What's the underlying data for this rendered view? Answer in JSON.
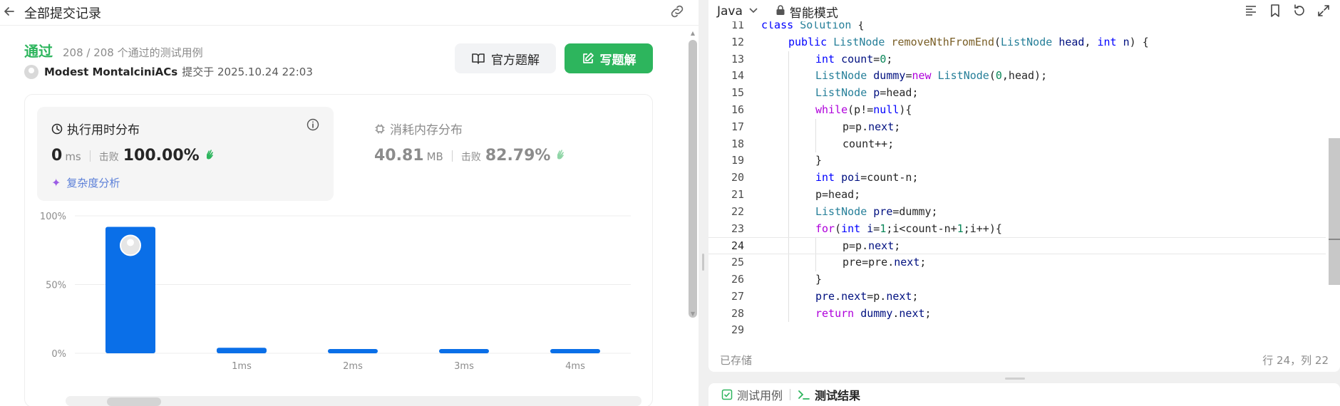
{
  "header": {
    "back_icon": "arrow-left-icon",
    "title": "全部提交记录",
    "link_icon": "link-icon"
  },
  "submission": {
    "status": "通过",
    "cases": "208 / 208 个通过的测试用例",
    "author": "Modest MontalciniACs",
    "submitted": "提交于 2025.10.24 22:03"
  },
  "buttons": {
    "official": "官方题解",
    "write": "写题解"
  },
  "runtime": {
    "title": "执行用时分布",
    "value": "0",
    "unit": "ms",
    "beat_label": "击败",
    "beat_pct": "100.00%",
    "complexity": "复杂度分析"
  },
  "memory": {
    "title": "消耗内存分布",
    "value": "40.81",
    "unit": "MB",
    "beat_label": "击败",
    "beat_pct": "82.79%"
  },
  "chart_data": {
    "type": "bar",
    "categories": [
      "0ms",
      "1ms",
      "2ms",
      "3ms",
      "4ms"
    ],
    "x_tick_labels": [
      "",
      "1ms",
      "2ms",
      "3ms",
      "4ms"
    ],
    "values": [
      92,
      4,
      3,
      3,
      3
    ],
    "y_tick_labels": [
      "100%",
      "50%",
      "0%"
    ],
    "ylim": [
      0,
      100
    ],
    "highlight_index": 0,
    "bar_color": "#0a6fe8",
    "grid": true
  },
  "editor": {
    "language": "Java",
    "mode": "智能模式",
    "saved": "已存储",
    "cursor": "行 24，列 22",
    "code_lines": [
      {
        "n": "11",
        "indent": 0,
        "html": "<span class=\"k\">class</span> <span class=\"t\">Solution</span> {"
      },
      {
        "n": "12",
        "indent": 1,
        "html": "<span class=\"k\">public</span> <span class=\"t\">ListNode</span> <span class=\"f\">removeNthFromEnd</span>(<span class=\"t\">ListNode</span> <span class=\"v\">head</span>, <span class=\"k\">int</span> <span class=\"v\">n</span>) {"
      },
      {
        "n": "13",
        "indent": 2,
        "html": "<span class=\"k\">int</span> <span class=\"v\">count</span>=<span class=\"n\">0</span>;"
      },
      {
        "n": "14",
        "indent": 2,
        "html": "<span class=\"t\">ListNode</span> <span class=\"v\">dummy</span>=<span class=\"kw\">new</span> <span class=\"t\">ListNode</span>(<span class=\"n\">0</span>,head);"
      },
      {
        "n": "15",
        "indent": 2,
        "html": "<span class=\"t\">ListNode</span> <span class=\"v\">p</span>=head;"
      },
      {
        "n": "16",
        "indent": 2,
        "html": "<span class=\"kw\">while</span>(p!=<span class=\"k\">null</span>){"
      },
      {
        "n": "17",
        "indent": 3,
        "html": "p=p.<span class=\"v\">next</span>;"
      },
      {
        "n": "18",
        "indent": 3,
        "html": "count++;"
      },
      {
        "n": "19",
        "indent": 2,
        "html": "}"
      },
      {
        "n": "20",
        "indent": 2,
        "html": "<span class=\"k\">int</span> <span class=\"v\">poi</span>=count-n;"
      },
      {
        "n": "21",
        "indent": 2,
        "html": "p=head;"
      },
      {
        "n": "22",
        "indent": 2,
        "html": "<span class=\"t\">ListNode</span> <span class=\"v\">pre</span>=dummy;"
      },
      {
        "n": "23",
        "indent": 2,
        "html": "<span class=\"kw\">for</span>(<span class=\"k\">int</span> <span class=\"v\">i</span>=<span class=\"n\">1</span>;i&lt;count-n+<span class=\"n\">1</span>;i++){"
      },
      {
        "n": "24",
        "indent": 3,
        "html": "p=p.<span class=\"v\">next</span>;"
      },
      {
        "n": "25",
        "indent": 3,
        "html": "pre=pre.<span class=\"v\">next</span>;"
      },
      {
        "n": "26",
        "indent": 2,
        "html": "}"
      },
      {
        "n": "27",
        "indent": 2,
        "html": "<span class=\"v\">pre</span>.<span class=\"v\">next</span>=p.<span class=\"v\">next</span>;"
      },
      {
        "n": "28",
        "indent": 2,
        "html": "<span class=\"kw\">return</span> <span class=\"v\">dummy</span>.<span class=\"v\">next</span>;"
      },
      {
        "n": "29",
        "indent": 0,
        "html": ""
      }
    ],
    "current_line": "24"
  },
  "tests": {
    "tab_cases": "测试用例",
    "tab_result": "测试结果"
  },
  "colors": {
    "accent_green": "#2db55d",
    "bar_blue": "#0a6fe8",
    "link_blue": "#5b7fd8"
  }
}
